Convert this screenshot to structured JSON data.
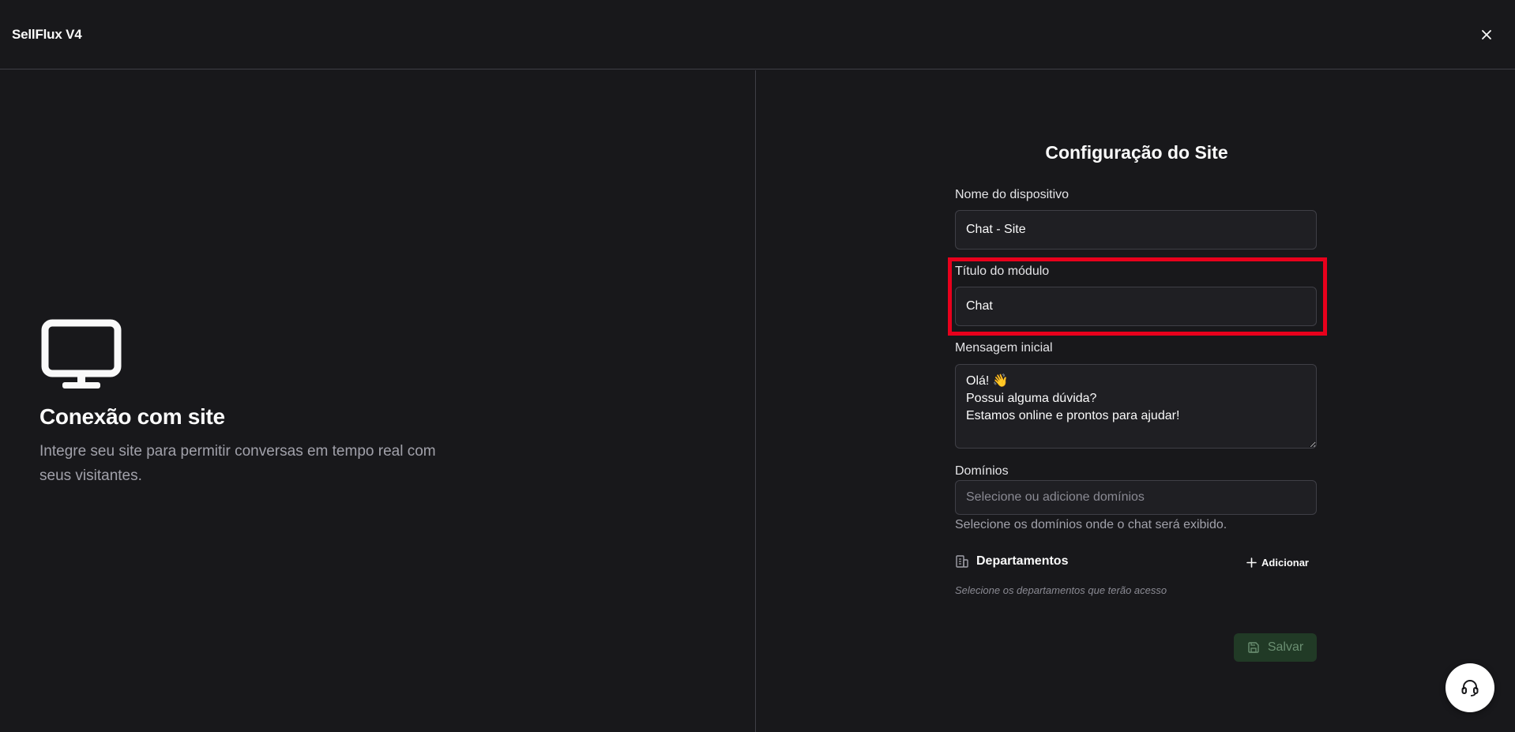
{
  "header": {
    "app_title": "SellFlux V4",
    "close_icon": "close-icon"
  },
  "left_panel": {
    "icon": "monitor-icon",
    "title": "Conexão com site",
    "description": "Integre seu site para permitir conversas em tempo real com seus visitantes."
  },
  "form": {
    "title": "Configuração do Site",
    "device_name": {
      "label": "Nome do dispositivo",
      "value": "Chat - Site"
    },
    "module_title": {
      "label": "Título do módulo",
      "value": "Chat"
    },
    "initial_message": {
      "label": "Mensagem inicial",
      "value": "Olá! 👋\nPossui alguma dúvida?\nEstamos online e prontos para ajudar!"
    },
    "domains": {
      "label": "Domínios",
      "placeholder": "Selecione ou adicione domínios",
      "hint": "Selecione os domínios onde o chat será exibido."
    },
    "departments": {
      "icon": "building-icon",
      "title": "Departamentos",
      "add_label": "Adicionar",
      "hint": "Selecione os departamentos que terão acesso"
    },
    "save_label": "Salvar"
  },
  "support": {
    "icon": "headset-icon"
  },
  "colors": {
    "background": "#18181b",
    "border": "#3f3f46",
    "highlight": "#e8001c",
    "save_bg": "#213a26",
    "save_text": "#6b8f72"
  }
}
